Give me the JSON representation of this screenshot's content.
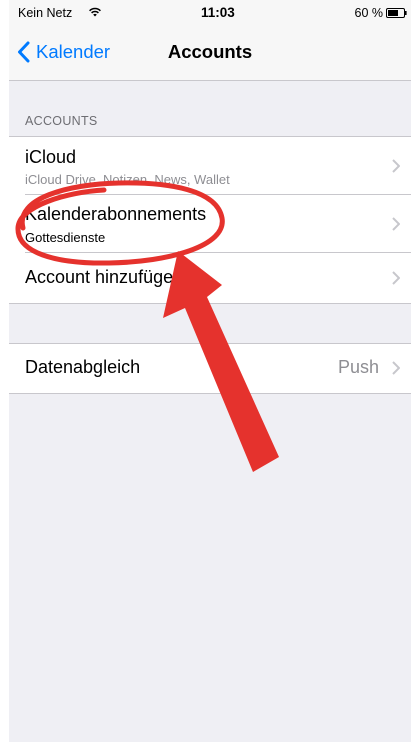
{
  "status_bar": {
    "carrier": "Kein Netz",
    "time": "11:03",
    "battery": "60 %",
    "wifi_icon": "wifi-icon",
    "battery_icon": "battery-icon"
  },
  "nav": {
    "back_label": "Kalender",
    "title": "Accounts",
    "back_icon": "chevron-left-icon"
  },
  "accounts_section": {
    "header": "ACCOUNTS",
    "rows": [
      {
        "title": "iCloud",
        "subtitle": "iCloud Drive, Notizen, News, Wallet"
      },
      {
        "title": "Kalenderabonnements",
        "subtitle": "Gottesdienste"
      },
      {
        "title": "Account hinzufügen"
      }
    ]
  },
  "sync_section": {
    "title": "Datenabgleich",
    "value": "Push"
  },
  "colors": {
    "accent": "#007aff",
    "annotation": "#e5322d",
    "background": "#efeff4"
  }
}
